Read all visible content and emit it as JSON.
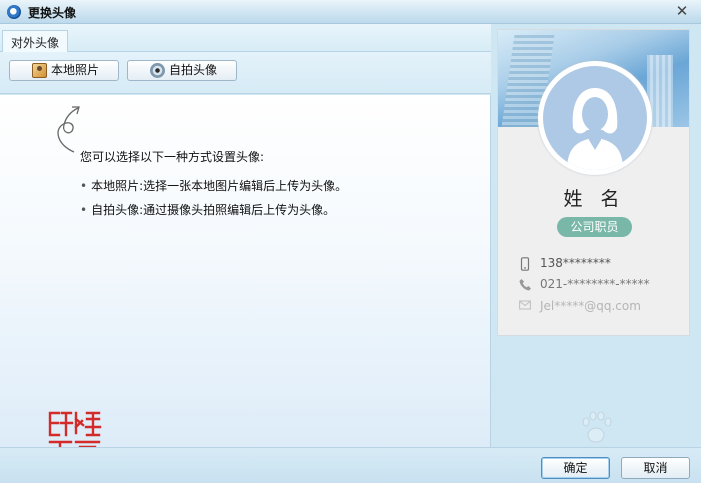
{
  "window": {
    "title": "更换头像",
    "close_symbol": "✕"
  },
  "tabs": [
    {
      "label": "对外头像",
      "active": true
    }
  ],
  "toolbar": {
    "local_photo_label": "本地照片",
    "self_photo_label": "自拍头像"
  },
  "content": {
    "intro": "您可以选择以下一种方式设置头像:",
    "options": [
      "本地照片:选择一张本地图片编辑后上传为头像。",
      "自拍头像:通过摄像头拍照编辑后上传为头像。"
    ]
  },
  "card": {
    "name": "姓 名",
    "role": "公司职员",
    "phone": "138********",
    "tel": "021-********-*****",
    "email": "Jel*****@qq.com"
  },
  "footer": {
    "ok_label": "确定",
    "cancel_label": "取消"
  },
  "colors": {
    "role_badge": "#79b8a9",
    "accent": "#4e8ec0"
  }
}
